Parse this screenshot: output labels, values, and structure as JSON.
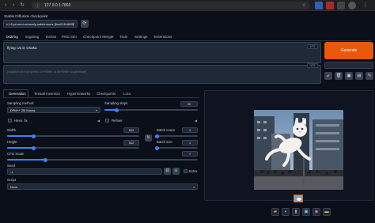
{
  "browser": {
    "url": "127.0.0.1:7860"
  },
  "checkpoint": {
    "label": "Stable Diffusion checkpoint",
    "value": "v1-5-pruned-emaonly.safetensors [6ce0161689]"
  },
  "top_tabs": [
    "txt2img",
    "img2img",
    "Extras",
    "PNG Info",
    "Checkpoint Merger",
    "Train",
    "Settings",
    "Extensions"
  ],
  "prompt": {
    "value": "flying cat in Osaka",
    "token_count": "4/75",
    "neg_placeholder": "Negative prompt (press Ctrl+Enter or Alt+Enter to generate)",
    "neg_token_count": "0/75"
  },
  "generate_label": "Generate",
  "sub_tabs": [
    "Generation",
    "Textual Inversion",
    "Hypernetworks",
    "Checkpoints",
    "Lora"
  ],
  "settings": {
    "sampling_method_label": "Sampling method",
    "sampling_method_value": "DPM++ 2M Karras",
    "sampling_steps_label": "Sampling steps",
    "sampling_steps_value": "20",
    "sampling_steps_fraction": 0.13,
    "hires_label": "Hires. fix",
    "refiner_label": "Refiner",
    "width_label": "Width",
    "width_value": "512",
    "width_fraction": 0.2,
    "height_label": "Height",
    "height_value": "512",
    "height_fraction": 0.2,
    "batch_count_label": "Batch count",
    "batch_count_value": "1",
    "batch_size_label": "Batch size",
    "batch_size_value": "1",
    "cfg_label": "CFG Scale",
    "cfg_value": "7",
    "cfg_fraction": 0.2,
    "seed_label": "Seed",
    "seed_value": "-1",
    "extra_label": "Extra",
    "script_label": "Script",
    "script_value": "None"
  },
  "colors": {
    "accent": "#ea580c",
    "slider": "#3b82f6",
    "background": "#0b0f19"
  },
  "icons": {
    "refresh": "refresh-icon",
    "swap": "swap-icon",
    "dice": "dice-icon",
    "recycle": "recycle-icon",
    "folder": "folder-icon",
    "save": "save-icon",
    "zip": "zip-icon",
    "image": "image-icon",
    "palette": "palette-icon",
    "ruler": "ruler-icon"
  }
}
